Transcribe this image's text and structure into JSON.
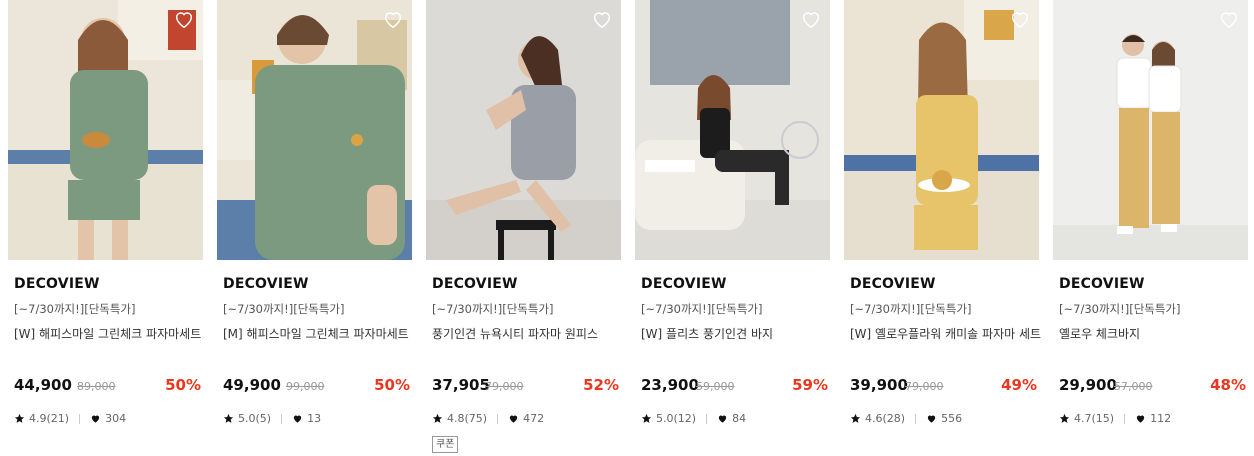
{
  "colors": {
    "discount": "#e8381f",
    "text": "#111111",
    "muted": "#9a9a9a"
  },
  "products": [
    {
      "brand": "DECOVIEW",
      "promo": "[~7/30까지!][단독특가]",
      "name": "[W] 해피스마일 그린체크 파자마세트",
      "price": "44,900",
      "original_price": "89,000",
      "discount": "50%",
      "rating": "4.9(21)",
      "likes": "304",
      "badge": ""
    },
    {
      "brand": "DECOVIEW",
      "promo": "[~7/30까지!][단독특가]",
      "name": "[M] 해피스마일 그린체크 파자마세트",
      "price": "49,900",
      "original_price": "99,000",
      "discount": "50%",
      "rating": "5.0(5)",
      "likes": "13",
      "badge": ""
    },
    {
      "brand": "DECOVIEW",
      "promo": "[~7/30까지!][단독특가]",
      "name": "풍기인견 뉴욕시티 파자마 원피스",
      "price": "37,905",
      "original_price": "79,000",
      "discount": "52%",
      "rating": "4.8(75)",
      "likes": "472",
      "badge": "쿠폰"
    },
    {
      "brand": "DECOVIEW",
      "promo": "[~7/30까지!][단독특가]",
      "name": "[W] 플리츠 풍기인견 바지",
      "price": "23,900",
      "original_price": "59,000",
      "discount": "59%",
      "rating": "5.0(12)",
      "likes": "84",
      "badge": ""
    },
    {
      "brand": "DECOVIEW",
      "promo": "[~7/30까지!][단독특가]",
      "name": "[W] 옐로우플라워 캐미솔 파자마 세트",
      "price": "39,900",
      "original_price": "79,000",
      "discount": "49%",
      "rating": "4.6(28)",
      "likes": "556",
      "badge": ""
    },
    {
      "brand": "DECOVIEW",
      "promo": "[~7/30까지!][단독특가]",
      "name": "옐로우 체크바지",
      "price": "29,900",
      "original_price": "57,000",
      "discount": "48%",
      "rating": "4.7(15)",
      "likes": "112",
      "badge": ""
    }
  ]
}
